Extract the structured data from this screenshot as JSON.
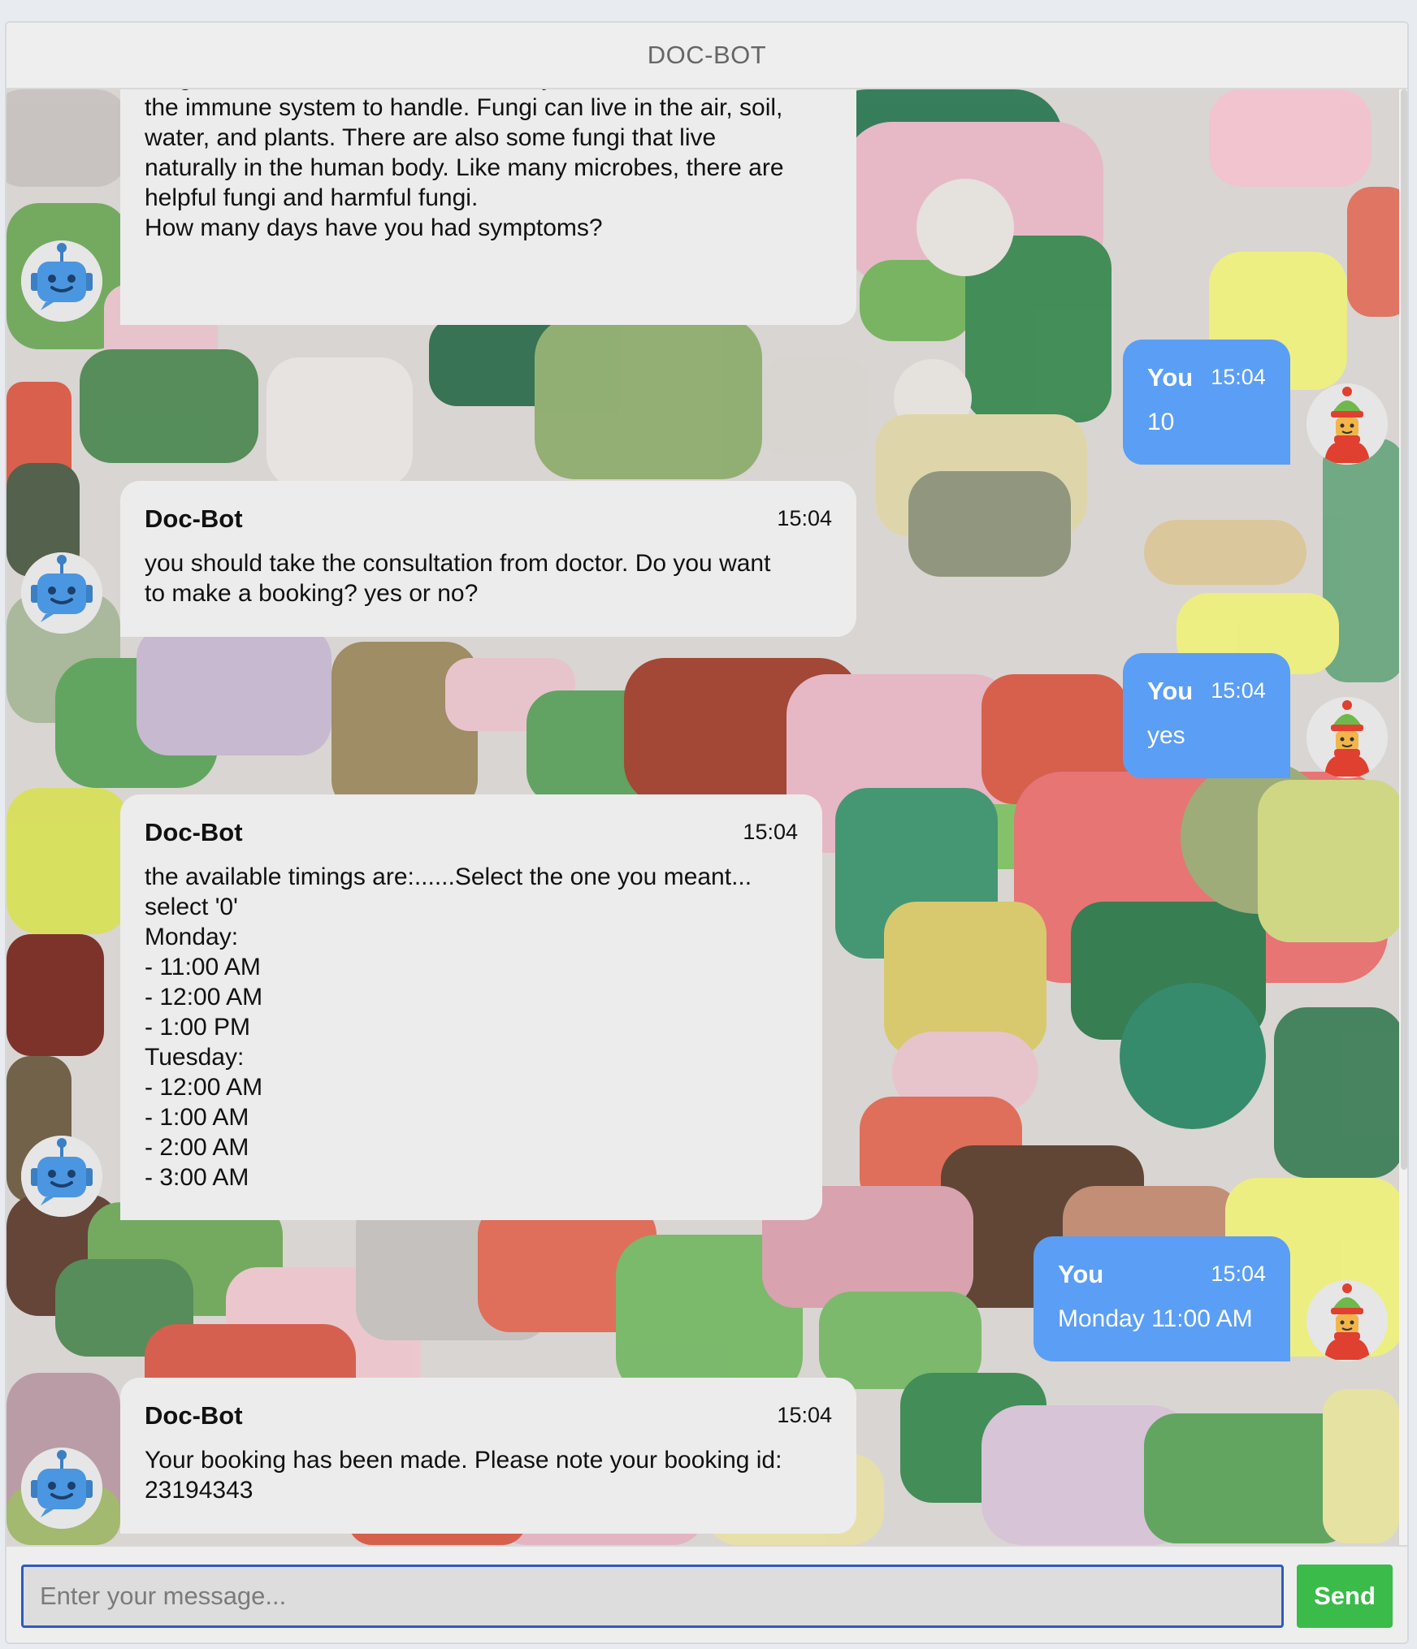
{
  "header": {
    "title": "DOC-BOT"
  },
  "colors": {
    "bot_bubble": "#ececec",
    "user_bubble": "#5b9ef5",
    "send_button": "#3bbb4a",
    "input_border": "#2f5bbd"
  },
  "messages": [
    {
      "sender": "",
      "time": "",
      "text": "In humans, fungal infections occur when an invading\nfungus takes over an area of the body and is too much for\nthe immune system to handle. Fungi can live in the air, soil,\nwater, and plants. There are also some fungi that live\nnaturally in the human body. Like many microbes, there are\nhelpful fungi and harmful fungi.\nHow many days have you had symptoms?",
      "avatar": "robot-icon"
    },
    {
      "sender": "You",
      "time": "15:04",
      "text": "10",
      "avatar": "user-winter-hat-icon"
    },
    {
      "sender": "Doc-Bot",
      "time": "15:04",
      "text": "you should take the consultation from doctor. Do you want\nto make a booking? yes or no?",
      "avatar": "robot-icon"
    },
    {
      "sender": "You",
      "time": "15:04",
      "text": "yes",
      "avatar": "user-winter-hat-icon"
    },
    {
      "sender": "Doc-Bot",
      "time": "15:04",
      "text": "the available timings are:......Select the one you meant...\nselect '0'\nMonday:\n- 11:00 AM\n- 12:00 AM\n- 1:00 PM\nTuesday:\n- 12:00 AM\n- 1:00 AM\n- 2:00 AM\n- 3:00 AM",
      "avatar": "robot-icon"
    },
    {
      "sender": "You",
      "time": "15:04",
      "text": "Monday 11:00 AM",
      "avatar": "user-winter-hat-icon"
    },
    {
      "sender": "Doc-Bot",
      "time": "15:04",
      "text": "Your booking has been made. Please note your booking id:\n23194343",
      "avatar": "robot-icon"
    }
  ],
  "composer": {
    "placeholder": "Enter your message...",
    "send_label": "Send"
  }
}
